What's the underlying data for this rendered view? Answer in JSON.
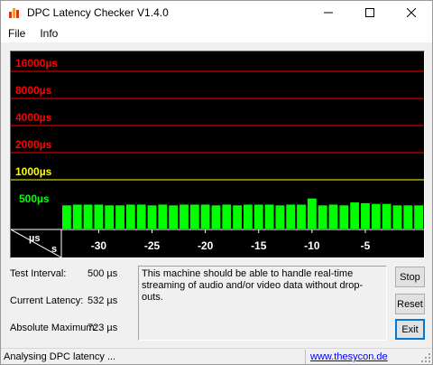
{
  "window": {
    "title": "DPC Latency Checker V1.4.0"
  },
  "menu": {
    "items": [
      "File",
      "Info"
    ]
  },
  "chart_data": {
    "type": "bar",
    "y_scale": "log",
    "y_ticks": [
      {
        "label": "16000µs",
        "value": 16000,
        "color": "#ff0000"
      },
      {
        "label": "8000µs",
        "value": 8000,
        "color": "#ff0000"
      },
      {
        "label": "4000µs",
        "value": 4000,
        "color": "#ff0000"
      },
      {
        "label": "2000µs",
        "value": 2000,
        "color": "#ff0000"
      },
      {
        "label": "1000µs",
        "value": 1000,
        "color": "#ffff00"
      },
      {
        "label": "500µs",
        "value": 500,
        "color": "#00ff00"
      }
    ],
    "x_axis": {
      "unit_y_label": "µs",
      "unit_x_label": "s",
      "ticks": [
        {
          "label": "-30",
          "value": -30
        },
        {
          "label": "-25",
          "value": -25
        },
        {
          "label": "-20",
          "value": -20
        },
        {
          "label": "-15",
          "value": -15
        },
        {
          "label": "-10",
          "value": -10
        },
        {
          "label": "-5",
          "value": -5
        }
      ]
    },
    "series": [
      {
        "color": "#00ff00",
        "x": [
          -33,
          -32,
          -31,
          -30,
          -29,
          -28,
          -27,
          -26,
          -25,
          -24,
          -23,
          -22,
          -21,
          -20,
          -19,
          -18,
          -17,
          -16,
          -15,
          -14,
          -13,
          -12,
          -11,
          -10,
          -9,
          -8,
          -7,
          -6,
          -5,
          -4,
          -3,
          -2,
          -1,
          0
        ],
        "values": [
          520,
          530,
          530,
          530,
          520,
          520,
          530,
          530,
          520,
          530,
          520,
          530,
          530,
          530,
          520,
          530,
          520,
          530,
          530,
          530,
          520,
          530,
          530,
          620,
          520,
          530,
          520,
          560,
          550,
          540,
          540,
          520,
          520,
          520
        ]
      }
    ],
    "colors": {
      "background": "#000000",
      "bar": "#00ff00",
      "danger_line": "#ff0000",
      "warn_line": "#ffff00",
      "axis": "#ffffff"
    }
  },
  "stats": {
    "test_interval_label": "Test Interval:",
    "test_interval_value": "500 µs",
    "current_latency_label": "Current Latency:",
    "current_latency_value": "532 µs",
    "absolute_maximum_label": "Absolute Maximum:",
    "absolute_maximum_value": "723 µs"
  },
  "message": "This machine should be able to handle real-time streaming of audio and/or video data without drop-outs.",
  "buttons": {
    "stop": "Stop",
    "reset": "Reset",
    "exit": "Exit"
  },
  "status": {
    "text": "Analysing DPC latency ...",
    "link": "www.thesycon.de"
  }
}
